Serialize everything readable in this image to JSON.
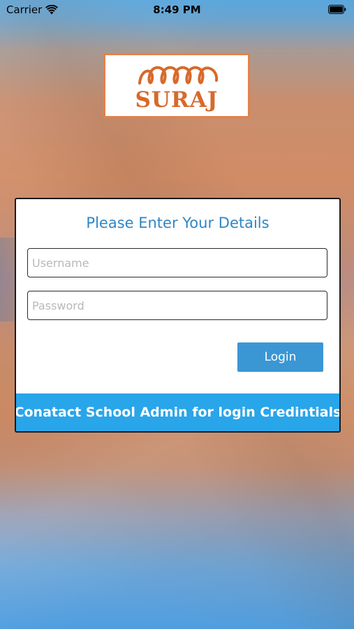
{
  "status_bar": {
    "carrier": "Carrier",
    "time": "8:49 PM"
  },
  "logo": {
    "text": "SURAJ",
    "color": "#d8692a"
  },
  "login_card": {
    "title": "Please Enter Your Details",
    "username": {
      "value": "",
      "placeholder": "Username"
    },
    "password": {
      "value": "",
      "placeholder": "Password"
    },
    "login_label": "Login",
    "footer_note": "Conatact School Admin for login Credintials"
  },
  "colors": {
    "accent": "#2f86c6",
    "button": "#3a97d4",
    "footer": "#29a5ea",
    "logo_border": "#e6814a"
  }
}
